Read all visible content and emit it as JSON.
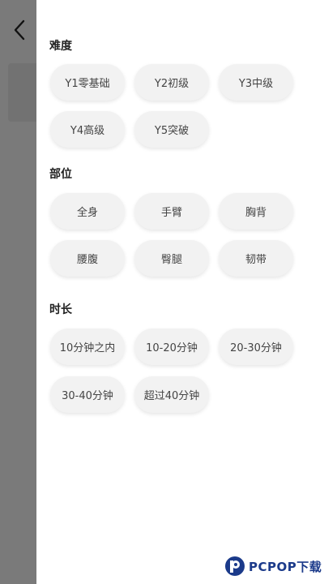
{
  "filter": {
    "sections": [
      {
        "title": "难度",
        "options": [
          "Y1零基础",
          "Y2初级",
          "Y3中级",
          "Y4高级",
          "Y5突破"
        ]
      },
      {
        "title": "部位",
        "options": [
          "全身",
          "手臂",
          "胸背",
          "腰腹",
          "臀腿",
          "韧带"
        ]
      },
      {
        "title": "时长",
        "options": [
          "10分钟之内",
          "10-20分钟",
          "20-30分钟",
          "30-40分钟",
          "超过40分钟"
        ]
      }
    ]
  },
  "watermark": {
    "text": "PCPOP下载"
  },
  "colors": {
    "overlay": "#7a7a7a",
    "chip_background": "#f2f2f2",
    "watermark": "#1b3a8a"
  }
}
